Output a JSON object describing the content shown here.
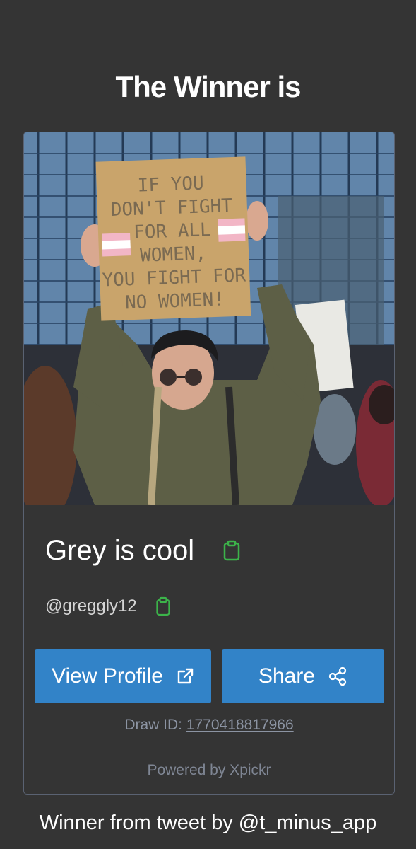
{
  "header": {
    "title": "The Winner is"
  },
  "winner": {
    "image_alt": "Winner profile photo",
    "sign_lines": [
      "IF YOU",
      "DON'T FIGHT",
      "FOR ALL",
      "WOMEN,",
      "YOU FIGHT FOR",
      "NO WOMEN!"
    ],
    "name": "Grey is cool",
    "handle": "@greggly12",
    "copy_icon": "clipboard-icon"
  },
  "actions": {
    "view_profile_label": "View Profile",
    "view_profile_icon": "external-link-icon",
    "share_label": "Share",
    "share_icon": "share-icon"
  },
  "draw": {
    "label": "Draw ID: ",
    "id": "1770418817966"
  },
  "powered_by": "Powered by Xpickr",
  "footer": {
    "text": "Winner from tweet by @t_minus_app"
  },
  "colors": {
    "background": "#343434",
    "button": "#3283c8",
    "copy_icon": "#3cb34a",
    "muted_text": "#8c94a3",
    "card_border": "#5a6272"
  }
}
